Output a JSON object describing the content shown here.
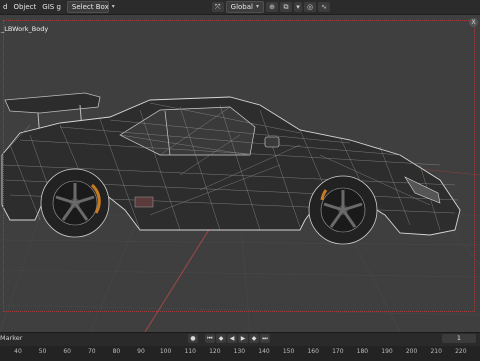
{
  "header": {
    "menu_items": [
      "d",
      "Object",
      "GIS"
    ],
    "gis_suffix": "g",
    "select_mode": "Select Box",
    "transform_orientation": "Global"
  },
  "viewport": {
    "object_label": "_LBWork_Body",
    "nav_buttons": [
      "X"
    ]
  },
  "timeline": {
    "marker_label": "Marker",
    "current_frame": "1",
    "ruler_ticks": [
      "40",
      "50",
      "60",
      "70",
      "80",
      "90",
      "100",
      "110",
      "120",
      "130",
      "140",
      "150",
      "160",
      "170",
      "180",
      "190",
      "200",
      "210",
      "220"
    ]
  },
  "icons": {
    "cursor": "cursor-icon",
    "pivot": "pivot-icon",
    "snap": "snap-icon",
    "proportional": "proportional-edit-icon",
    "wave": "curve-icon"
  }
}
